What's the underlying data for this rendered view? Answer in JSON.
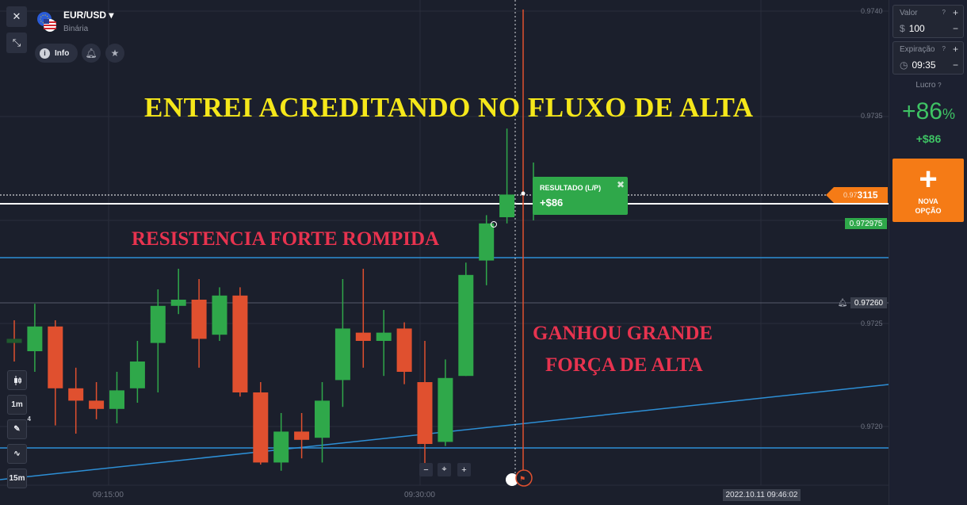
{
  "asset": {
    "pair": "EUR/USD",
    "type": "Binária",
    "info_label": "Info"
  },
  "annotations": {
    "title": "ENTREI ACREDITANDO NO FLUXO DE ALTA",
    "resistance": "RESISTENCIA FORTE ROMPIDA",
    "gain_line1": "GANHOU GRANDE",
    "gain_line2": "FORÇA DE ALTA"
  },
  "result": {
    "label": "RESULTADO (L/P)",
    "value": "+$86"
  },
  "price_axis": {
    "ticks": [
      "0.9740",
      "0.9735",
      "0.9725",
      "0.9720"
    ],
    "current_price_prefix": "0.97",
    "current_price_main": "3115",
    "entry_price": "0.972975",
    "alert_price": "0.97260"
  },
  "time_axis": {
    "ticks": [
      "09:15:00",
      "09:30:00"
    ],
    "cursor_time": "2022.10.11 09:46:02"
  },
  "toolbar": {
    "timeframe_candle": "1m",
    "timeframe_chart": "15m",
    "drawing_count": "4"
  },
  "panel": {
    "amount_title": "Valor",
    "amount_unit": "$",
    "amount_value": "100",
    "expiry_title": "Expiração",
    "expiry_value": "09:35",
    "profit_title": "Lucro",
    "profit_percent": "+86",
    "profit_percent_sign": "%",
    "profit_amount": "+$86",
    "new_option_line1": "NOVA",
    "new_option_line2": "OPÇÃO"
  },
  "colors": {
    "bull": "#2fa84a",
    "bear": "#e0502f",
    "accent": "#f57b16",
    "trendline": "#2d8fd6",
    "annotation_yellow": "#f5e71a",
    "annotation_red": "#e8334f"
  },
  "chart_data": {
    "type": "candlestick",
    "y_range": [
      0.97175,
      0.97405
    ],
    "candles": [
      {
        "o": 0.97246,
        "h": 0.97255,
        "l": 0.97235,
        "c": 0.97244
      },
      {
        "o": 0.9724,
        "h": 0.97263,
        "l": 0.9723,
        "c": 0.97252
      },
      {
        "o": 0.97252,
        "h": 0.97255,
        "l": 0.97204,
        "c": 0.97222
      },
      {
        "o": 0.97222,
        "h": 0.97232,
        "l": 0.972,
        "c": 0.97216
      },
      {
        "o": 0.97216,
        "h": 0.97225,
        "l": 0.97207,
        "c": 0.97212
      },
      {
        "o": 0.97212,
        "h": 0.9723,
        "l": 0.97205,
        "c": 0.97221
      },
      {
        "o": 0.97222,
        "h": 0.97245,
        "l": 0.97215,
        "c": 0.97235
      },
      {
        "o": 0.97244,
        "h": 0.9727,
        "l": 0.9722,
        "c": 0.97262
      },
      {
        "o": 0.97262,
        "h": 0.9728,
        "l": 0.97258,
        "c": 0.97265
      },
      {
        "o": 0.97265,
        "h": 0.97275,
        "l": 0.97232,
        "c": 0.97246
      },
      {
        "o": 0.97248,
        "h": 0.97271,
        "l": 0.97245,
        "c": 0.97267
      },
      {
        "o": 0.97267,
        "h": 0.97271,
        "l": 0.97218,
        "c": 0.9722
      },
      {
        "o": 0.9722,
        "h": 0.97225,
        "l": 0.97185,
        "c": 0.97186
      },
      {
        "o": 0.97186,
        "h": 0.9721,
        "l": 0.97182,
        "c": 0.97201
      },
      {
        "o": 0.97201,
        "h": 0.9721,
        "l": 0.97188,
        "c": 0.97197
      },
      {
        "o": 0.97198,
        "h": 0.97225,
        "l": 0.97186,
        "c": 0.97216
      },
      {
        "o": 0.97226,
        "h": 0.97275,
        "l": 0.97213,
        "c": 0.97251
      },
      {
        "o": 0.97249,
        "h": 0.9728,
        "l": 0.97232,
        "c": 0.97245
      },
      {
        "o": 0.97245,
        "h": 0.9726,
        "l": 0.97228,
        "c": 0.97249
      },
      {
        "o": 0.97251,
        "h": 0.97254,
        "l": 0.97224,
        "c": 0.9723
      },
      {
        "o": 0.97225,
        "h": 0.97245,
        "l": 0.97185,
        "c": 0.97195
      },
      {
        "o": 0.97196,
        "h": 0.97236,
        "l": 0.97194,
        "c": 0.97227
      },
      {
        "o": 0.97228,
        "h": 0.97283,
        "l": 0.97228,
        "c": 0.97277
      },
      {
        "o": 0.97284,
        "h": 0.97306,
        "l": 0.97272,
        "c": 0.97302
      },
      {
        "o": 0.97305,
        "h": 0.97348,
        "l": 0.97302,
        "c": 0.97316
      }
    ]
  }
}
